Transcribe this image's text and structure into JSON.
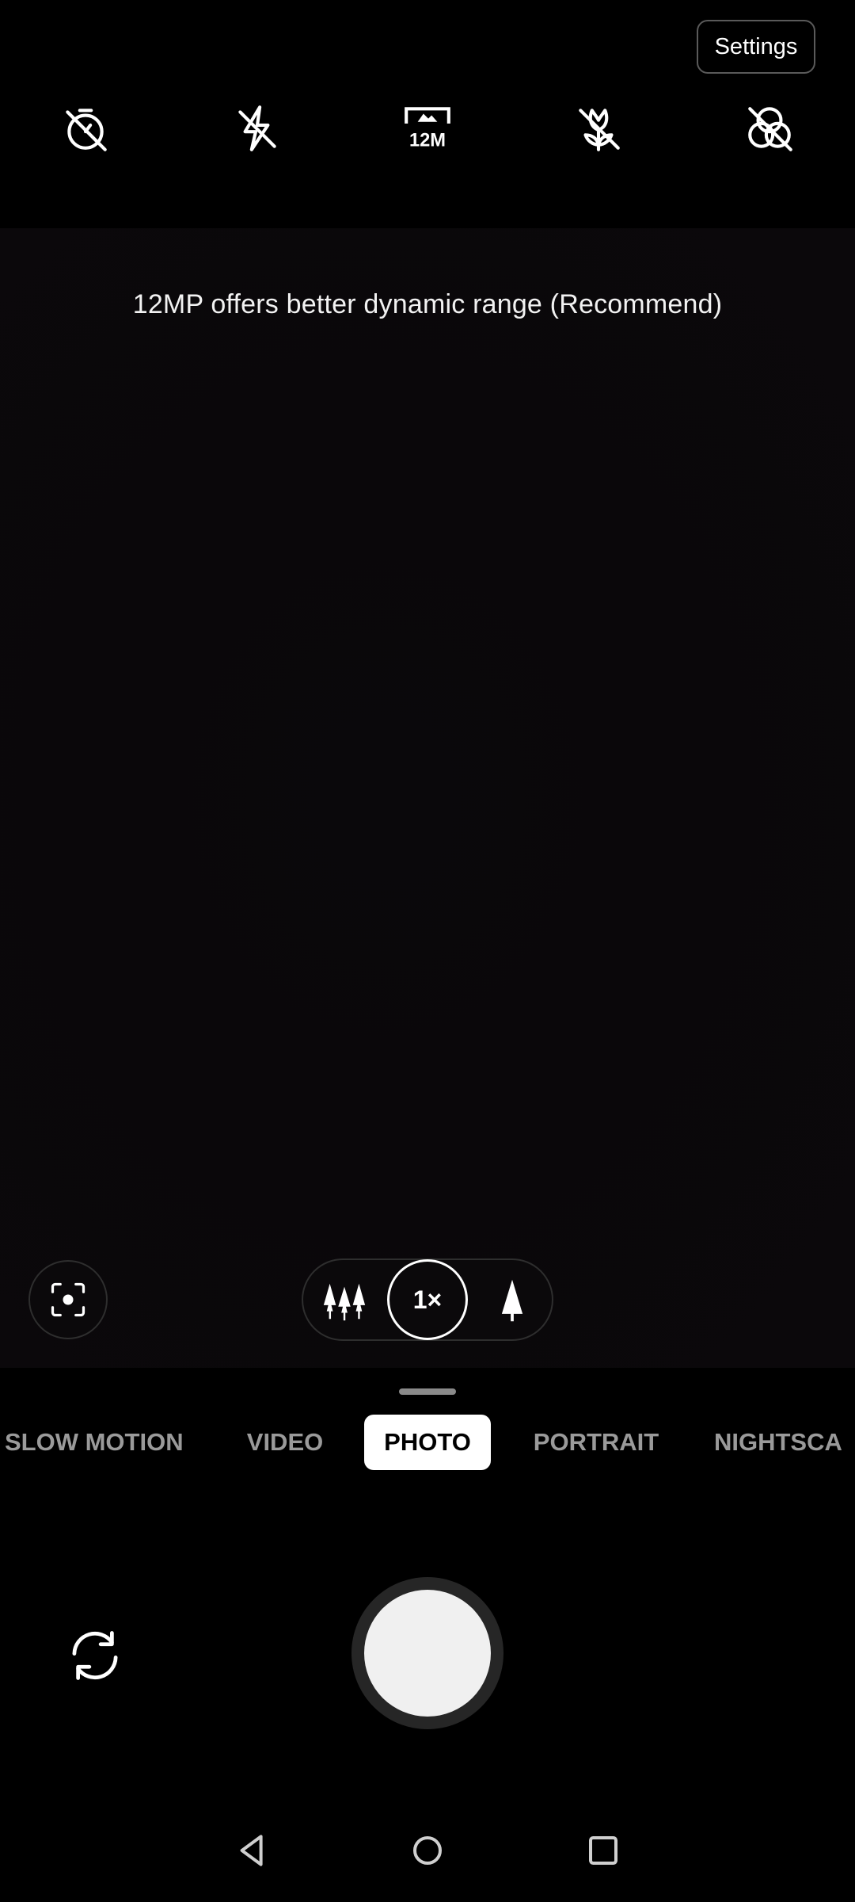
{
  "header": {
    "settings_label": "Settings"
  },
  "quick_settings": [
    {
      "icon": "timer-off-icon"
    },
    {
      "icon": "flash-off-icon"
    },
    {
      "icon": "resolution-12m-icon",
      "label": "12M"
    },
    {
      "icon": "macro-off-icon"
    },
    {
      "icon": "filter-off-icon"
    }
  ],
  "viewfinder": {
    "hint": "12MP offers better dynamic range (Recommend)"
  },
  "zoom": {
    "wide_icon": "ultra-wide-trees-icon",
    "current": "1×",
    "tele_icon": "telephoto-tree-icon"
  },
  "lens": {
    "icon": "google-lens-icon"
  },
  "modes": [
    "SLOW MOTION",
    "VIDEO",
    "PHOTO",
    "PORTRAIT",
    "NIGHTSCA"
  ],
  "active_mode": "PHOTO",
  "controls": {
    "flip_icon": "switch-camera-icon",
    "shutter_icon": "shutter-button"
  },
  "nav": {
    "back": "back-icon",
    "home": "home-icon",
    "recents": "recents-icon"
  },
  "colors": {
    "background": "#000000",
    "viewfinder": "#0a080b",
    "active_mode_bg": "#ffffff",
    "inactive_mode_text": "#9a9a9a"
  }
}
